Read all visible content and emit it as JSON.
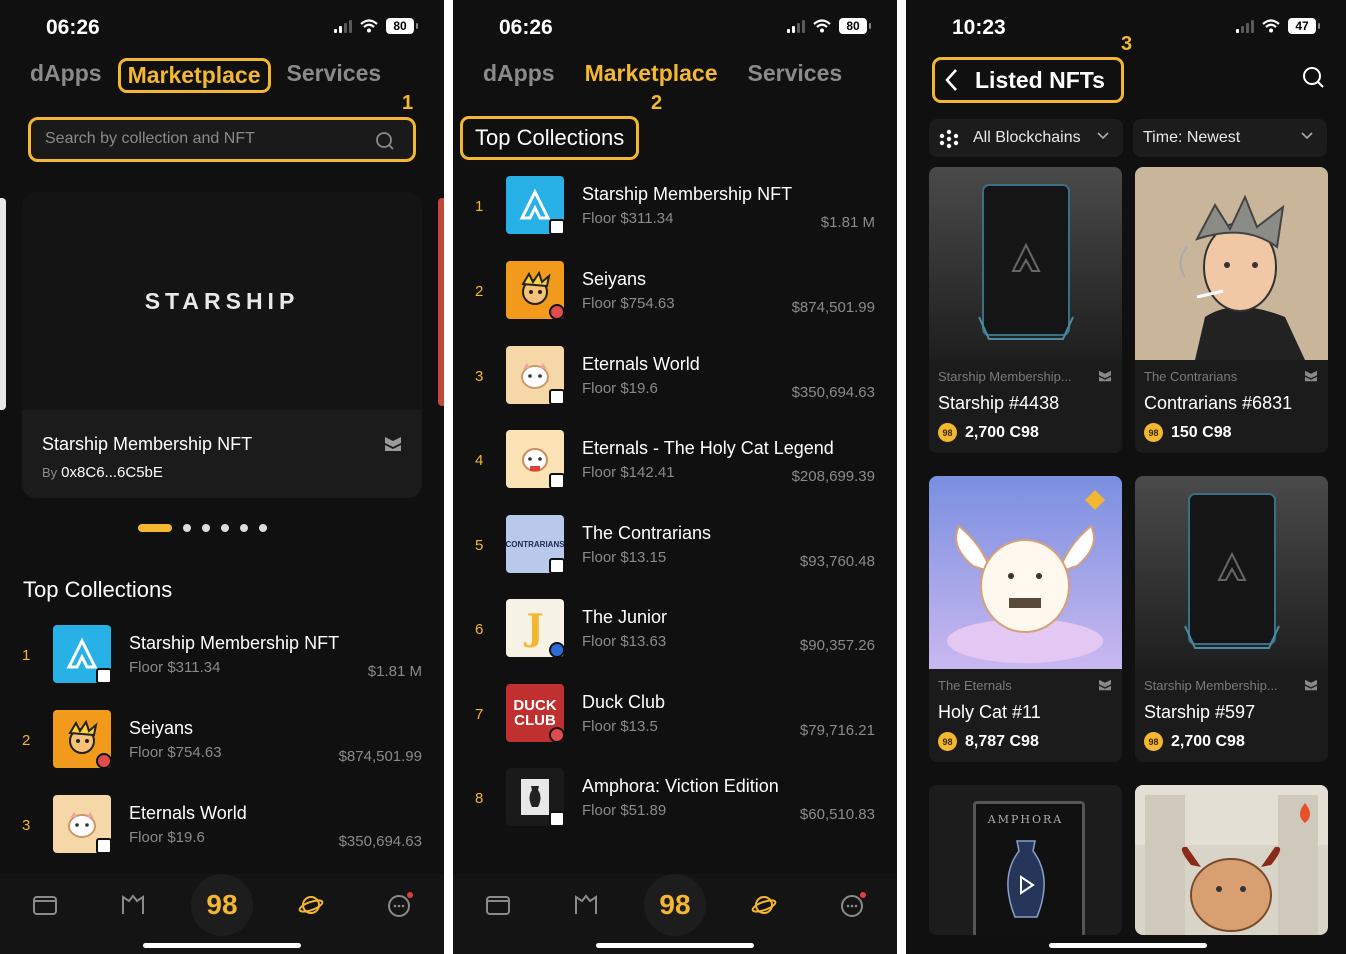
{
  "screen1": {
    "status": {
      "time": "06:26",
      "battery": "80"
    },
    "tabs": [
      "dApps",
      "Marketplace",
      "Services"
    ],
    "callout": "1",
    "search": {
      "placeholder": "Search by collection and NFT"
    },
    "banner": {
      "logo": "STARSHIP",
      "title": "Starship Membership NFT",
      "by_label": "By",
      "by_addr": "0x8C6...6C5bE"
    },
    "section_title": "Top Collections",
    "rows": [
      {
        "rank": "1",
        "name": "Starship Membership NFT",
        "floor": "Floor $311.34",
        "volume": "$1.81 M"
      },
      {
        "rank": "2",
        "name": "Seiyans",
        "floor": "Floor $754.63",
        "volume": "$874,501.99"
      },
      {
        "rank": "3",
        "name": "Eternals World",
        "floor": "Floor $19.6",
        "volume": "$350,694.63"
      }
    ],
    "tabbar_center": "98"
  },
  "screen2": {
    "status": {
      "time": "06:26",
      "battery": "80"
    },
    "tabs": [
      "dApps",
      "Marketplace",
      "Services"
    ],
    "callout": "2",
    "section_title": "Top Collections",
    "rows": [
      {
        "rank": "1",
        "name": "Starship Membership NFT",
        "floor": "Floor $311.34",
        "volume": "$1.81 M"
      },
      {
        "rank": "2",
        "name": "Seiyans",
        "floor": "Floor $754.63",
        "volume": "$874,501.99"
      },
      {
        "rank": "3",
        "name": "Eternals World",
        "floor": "Floor $19.6",
        "volume": "$350,694.63"
      },
      {
        "rank": "4",
        "name": "Eternals - The Holy Cat Legend",
        "floor": "Floor $142.41",
        "volume": "$208,699.39"
      },
      {
        "rank": "5",
        "name": "The Contrarians",
        "floor": "Floor $13.15",
        "volume": "$93,760.48",
        "thumb_text": "CONTRARIANS"
      },
      {
        "rank": "6",
        "name": "The Junior",
        "floor": "Floor $13.63",
        "volume": "$90,357.26",
        "thumb_text": "J"
      },
      {
        "rank": "7",
        "name": "Duck Club",
        "floor": "Floor $13.5",
        "volume": "$79,716.21",
        "thumb_text": "DUCK CLUB"
      },
      {
        "rank": "8",
        "name": "Amphora: Viction Edition",
        "floor": "Floor $51.89",
        "volume": "$60,510.83"
      }
    ],
    "tabbar_center": "98"
  },
  "screen3": {
    "status": {
      "time": "10:23",
      "battery": "47"
    },
    "callout": "3",
    "title": "Listed NFTs",
    "filters": {
      "chain": "All Blockchains",
      "sort": "Time: Newest"
    },
    "cards": [
      {
        "collection": "Starship Membership...",
        "name": "Starship #4438",
        "price": "2,700 C98"
      },
      {
        "collection": "The Contrarians",
        "name": "Contrarians #6831",
        "price": "150 C98"
      },
      {
        "collection": "The Eternals",
        "name": "Holy Cat #11",
        "price": "8,787 C98"
      },
      {
        "collection": "Starship Membership...",
        "name": "Starship #597",
        "price": "2,700 C98"
      }
    ],
    "partial_cards": [
      {
        "label": "AMPHORA"
      }
    ],
    "coin_label": "98"
  }
}
